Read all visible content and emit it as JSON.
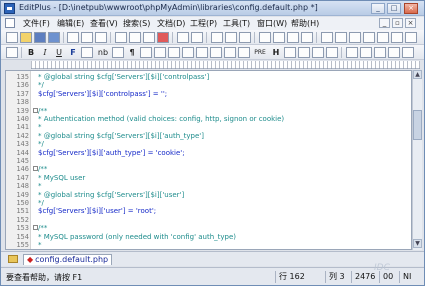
{
  "window": {
    "title": "EditPlus - [D:\\inetpub\\wwwroot\\phpMyAdmin\\libraries\\config.default.php *]"
  },
  "window_controls": {
    "minimize": "_",
    "maximize": "□",
    "close": "×"
  },
  "menubar": {
    "items": [
      {
        "label": "文件(F)"
      },
      {
        "label": "编辑(E)"
      },
      {
        "label": "查看(V)"
      },
      {
        "label": "搜索(S)"
      },
      {
        "label": "文档(D)"
      },
      {
        "label": "工程(P)"
      },
      {
        "label": "工具(T)"
      },
      {
        "label": "窗口(W)"
      },
      {
        "label": "帮助(H)"
      }
    ],
    "mdi_controls": {
      "minimize": "_",
      "restore": "▫",
      "close": "×"
    }
  },
  "toolbar2": {
    "bold": "B",
    "italic": "I",
    "underline": "U",
    "font": "F",
    "nbsp": "nb",
    "paragraph": "¶",
    "pre": "PRE",
    "heading": "H"
  },
  "editor": {
    "lines": [
      {
        "num": "135",
        "text": " * @global string $cfg['Servers'][$i]['controlpass']"
      },
      {
        "num": "136",
        "text": " */"
      },
      {
        "num": "137",
        "text": "$cfg['Servers'][$i]['controlpass'] = '';"
      },
      {
        "num": "138",
        "text": ""
      },
      {
        "num": "139",
        "text": "/**"
      },
      {
        "num": "140",
        "text": " * Authentication method (valid choices: config, http, signon or cookie)"
      },
      {
        "num": "141",
        "text": " *"
      },
      {
        "num": "142",
        "text": " * @global string $cfg['Servers'][$i]['auth_type']"
      },
      {
        "num": "143",
        "text": " */"
      },
      {
        "num": "144",
        "text": "$cfg['Servers'][$i]['auth_type'] = 'cookie';"
      },
      {
        "num": "145",
        "text": ""
      },
      {
        "num": "146",
        "text": "/**"
      },
      {
        "num": "147",
        "text": " * MySQL user"
      },
      {
        "num": "148",
        "text": " *"
      },
      {
        "num": "149",
        "text": " * @global string $cfg['Servers'][$i]['user']"
      },
      {
        "num": "150",
        "text": " */"
      },
      {
        "num": "151",
        "text": "$cfg['Servers'][$i]['user'] = 'root';"
      },
      {
        "num": "152",
        "text": ""
      },
      {
        "num": "153",
        "text": "/**"
      },
      {
        "num": "154",
        "text": " * MySQL password (only needed with 'config' auth_type)"
      },
      {
        "num": "155",
        "text": " *"
      }
    ]
  },
  "tabbar": {
    "file_tab": "config.default.php",
    "dirty_marker": "◆"
  },
  "statusbar": {
    "help": "要查看帮助，请按 F1",
    "line": "行 162",
    "col": "列 3",
    "chars": "2476",
    "mode1": "00",
    "mode2": "NI"
  },
  "watermark": "IDC"
}
